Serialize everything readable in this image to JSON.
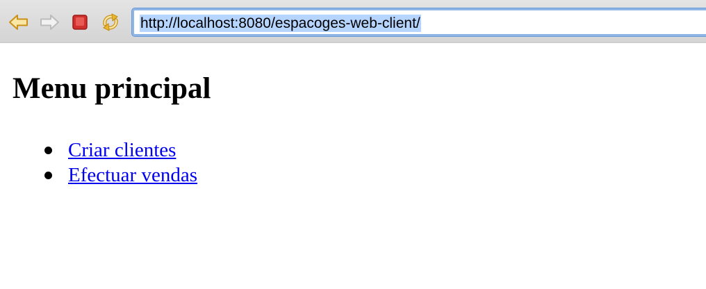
{
  "browser": {
    "address_url": "http://localhost:8080/espacoges-web-client/",
    "buttons": {
      "back": {
        "icon": "back-arrow-icon",
        "enabled": true
      },
      "forward": {
        "icon": "forward-arrow-icon",
        "enabled": false
      },
      "stop": {
        "icon": "stop-icon",
        "enabled": true
      },
      "reload": {
        "icon": "reload-icon",
        "enabled": true
      }
    },
    "colors": {
      "toolbar": "#d9d9d9",
      "address_focus": "#8fb5e6",
      "selection": "#b5d5ff",
      "icon_gold": "#e8b730",
      "icon_red": "#d0312d"
    }
  },
  "page": {
    "title": "Menu principal",
    "menu_items": [
      {
        "label": "Criar clientes"
      },
      {
        "label": "Efectuar vendas"
      }
    ],
    "colors": {
      "link": "#0000ee"
    }
  }
}
